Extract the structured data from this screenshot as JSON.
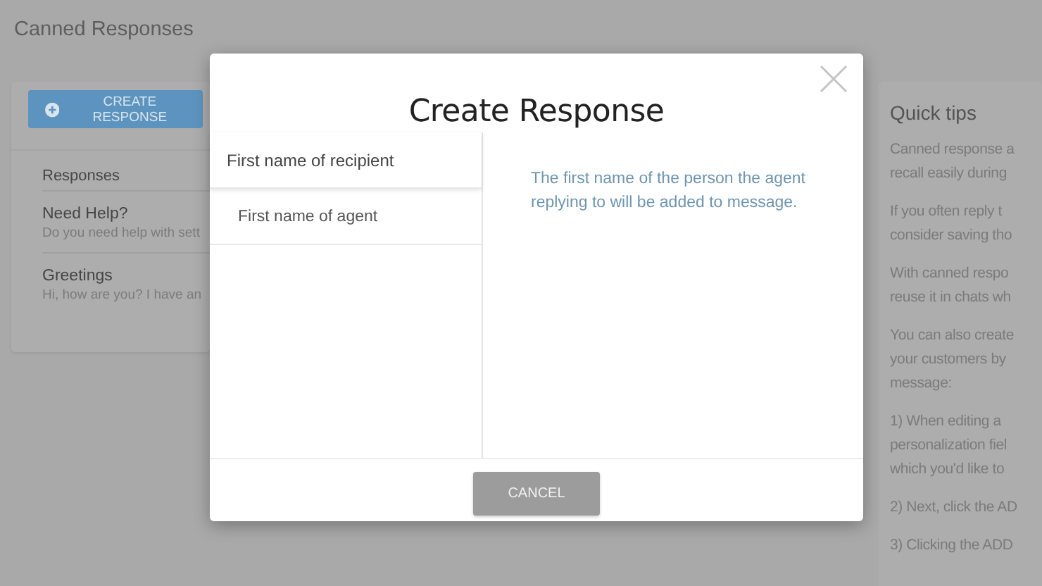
{
  "page": {
    "title": "Canned Responses"
  },
  "left_panel": {
    "create_button": "CREATE RESPONSE",
    "list_heading": "Responses",
    "responses": [
      {
        "title": "Need Help?",
        "preview": "Do you need help with sett"
      },
      {
        "title": "Greetings",
        "preview": "Hi, how are you? I have an"
      }
    ]
  },
  "quick_tips": {
    "title": "Quick tips",
    "paragraphs": [
      [
        "Canned response a",
        "recall easily during"
      ],
      [
        "If you often reply t",
        "consider saving tho"
      ],
      [
        "With canned respo",
        "reuse it in chats wh"
      ],
      [
        "You can also create",
        "your customers by",
        "message:"
      ],
      [
        "1) When editing a",
        "personalization fiel",
        "which you'd like to"
      ],
      [
        "2) Next, click the AD"
      ],
      [
        "3) Clicking the ADD"
      ]
    ]
  },
  "modal": {
    "title": "Create Response",
    "fields": [
      {
        "label": "First name of recipient",
        "selected": true
      },
      {
        "label": "First name of agent",
        "selected": false
      }
    ],
    "description": "The first name of the person the agent replying to will be added to message.",
    "cancel_button": "CANCEL"
  }
}
